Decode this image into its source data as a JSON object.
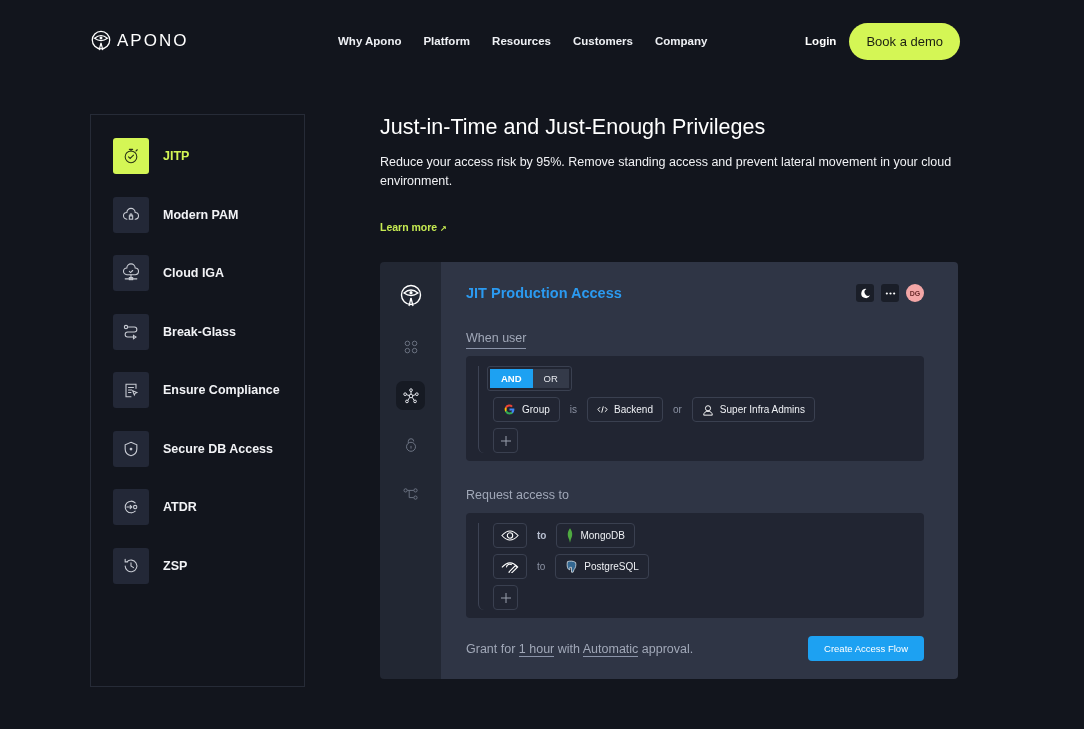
{
  "header": {
    "logo": "APONO",
    "nav": [
      "Why Apono",
      "Platform",
      "Resources",
      "Customers",
      "Company"
    ],
    "login": "Login",
    "cta": "Book a demo"
  },
  "sidebar": {
    "items": [
      {
        "label": "JITP",
        "kind": "stopwatch",
        "selected": true
      },
      {
        "label": "Modern PAM",
        "kind": "cloud-lock",
        "selected": false
      },
      {
        "label": "Cloud IGA",
        "kind": "cloud-network",
        "selected": false
      },
      {
        "label": "Break-Glass",
        "kind": "route",
        "selected": false
      },
      {
        "label": "Ensure Compliance",
        "kind": "document",
        "selected": false
      },
      {
        "label": "Secure DB Access",
        "kind": "shield",
        "selected": false
      },
      {
        "label": "ATDR",
        "kind": "cycle",
        "selected": false
      },
      {
        "label": "ZSP",
        "kind": "history",
        "selected": false
      }
    ]
  },
  "hero": {
    "title": "Just-in-Time and Just-Enough Privileges",
    "description": "Reduce your access risk by 95%. Remove standing access and prevent lateral movement in your cloud environment.",
    "link": "Learn more",
    "link_arrow": "↗"
  },
  "demo": {
    "rail": [
      {
        "kind": "grid",
        "selected": false
      },
      {
        "kind": "nodes",
        "selected": true
      },
      {
        "kind": "lock",
        "selected": false
      },
      {
        "kind": "flow",
        "selected": false
      }
    ],
    "title": "JIT Production Access",
    "avatar": "DG",
    "when_label": "When user",
    "operators": [
      {
        "label": "AND",
        "selected": true
      },
      {
        "label": "OR",
        "selected": false
      }
    ],
    "condition": {
      "attribute": "Group",
      "is": "is",
      "value": "Backend",
      "or": "or",
      "value_2": "Super Infra Admins"
    },
    "request_label": "Request access to",
    "grants": [
      {
        "kind": "view",
        "to": "to",
        "to_bold": true,
        "resource": {
          "label": "MongoDB",
          "kind": "mongo"
        }
      },
      {
        "kind": "edit",
        "to": "to",
        "to_bold": false,
        "resource": {
          "label": "PostgreSQL",
          "kind": "postgres"
        }
      }
    ],
    "sentence": [
      {
        "text": "Grant for ",
        "kind": "plain"
      },
      {
        "text": "1 hour",
        "kind": "choice"
      },
      {
        "text": " with ",
        "kind": "plain"
      },
      {
        "text": "Automatic",
        "kind": "choice"
      },
      {
        "text": " approval.",
        "kind": "plain"
      }
    ],
    "button": "Create Access Flow"
  }
}
